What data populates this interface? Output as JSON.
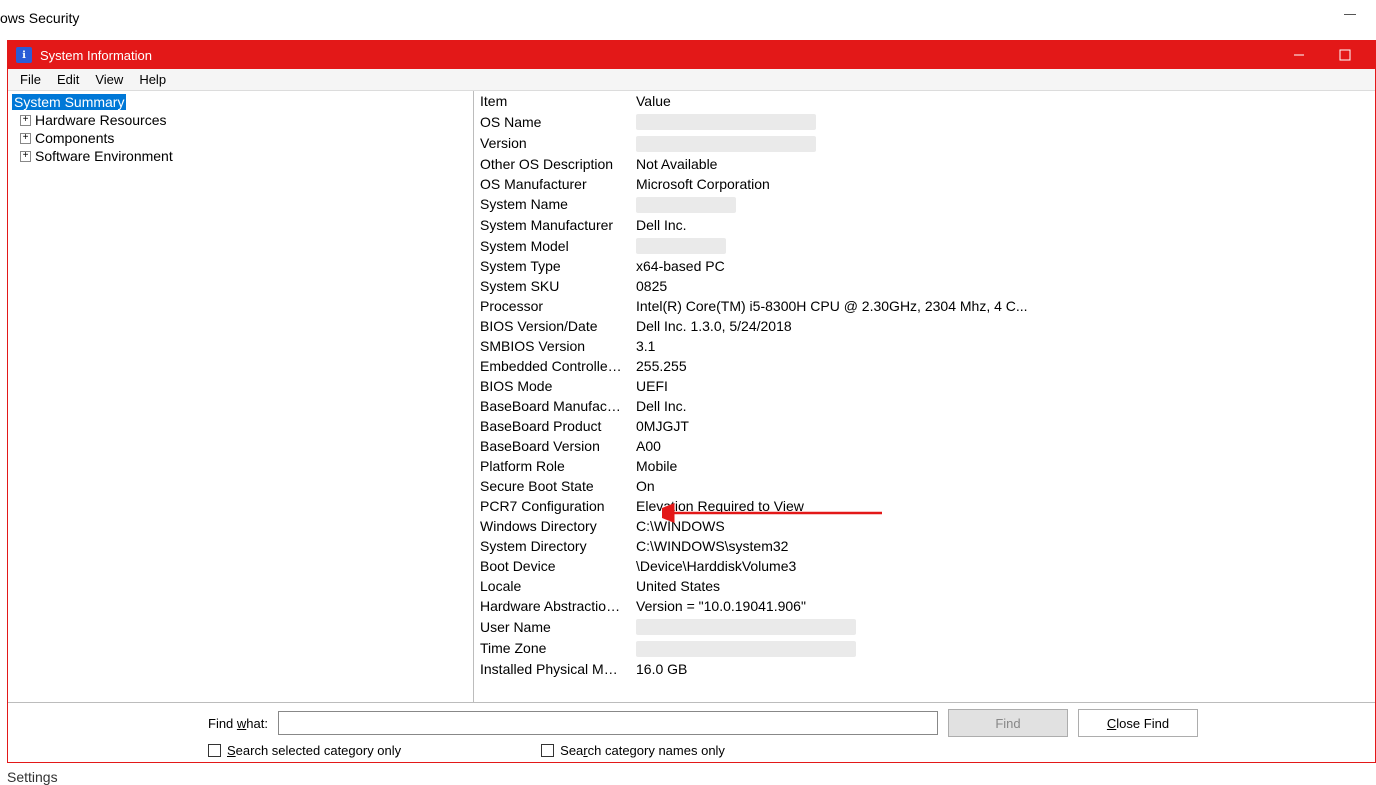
{
  "background": {
    "title_fragment": "ows Security",
    "settings_fragment": "Settings"
  },
  "msinfo": {
    "title": "System Information",
    "menu": {
      "file": "File",
      "edit": "Edit",
      "view": "View",
      "help": "Help"
    },
    "tree": {
      "root": "System Summary",
      "children": [
        "Hardware Resources",
        "Components",
        "Software Environment"
      ]
    },
    "headers": {
      "item": "Item",
      "value": "Value"
    },
    "rows": [
      {
        "item": "OS Name",
        "value": "",
        "redact_w": 180
      },
      {
        "item": "Version",
        "value": "",
        "redact_w": 180
      },
      {
        "item": "Other OS Description",
        "value": "Not Available"
      },
      {
        "item": "OS Manufacturer",
        "value": "Microsoft Corporation"
      },
      {
        "item": "System Name",
        "value": "",
        "redact_w": 100
      },
      {
        "item": "System Manufacturer",
        "value": "Dell Inc."
      },
      {
        "item": "System Model",
        "value": "",
        "redact_w": 90
      },
      {
        "item": "System Type",
        "value": "x64-based PC"
      },
      {
        "item": "System SKU",
        "value": "0825"
      },
      {
        "item": "Processor",
        "value": "Intel(R) Core(TM) i5-8300H CPU @ 2.30GHz, 2304 Mhz, 4 C..."
      },
      {
        "item": "BIOS Version/Date",
        "value": "Dell Inc. 1.3.0, 5/24/2018"
      },
      {
        "item": "SMBIOS Version",
        "value": "3.1"
      },
      {
        "item": "Embedded Controller V...",
        "value": "255.255"
      },
      {
        "item": "BIOS Mode",
        "value": "UEFI"
      },
      {
        "item": "BaseBoard Manufacturer",
        "value": "Dell Inc."
      },
      {
        "item": "BaseBoard Product",
        "value": "0MJGJT"
      },
      {
        "item": "BaseBoard Version",
        "value": "A00"
      },
      {
        "item": "Platform Role",
        "value": "Mobile"
      },
      {
        "item": "Secure Boot State",
        "value": "On"
      },
      {
        "item": "PCR7 Configuration",
        "value": "Elevation Required to View"
      },
      {
        "item": "Windows Directory",
        "value": "C:\\WINDOWS"
      },
      {
        "item": "System Directory",
        "value": "C:\\WINDOWS\\system32"
      },
      {
        "item": "Boot Device",
        "value": "\\Device\\HarddiskVolume3"
      },
      {
        "item": "Locale",
        "value": "United States"
      },
      {
        "item": "Hardware Abstraction L...",
        "value": "Version = \"10.0.19041.906\""
      },
      {
        "item": "User Name",
        "value": "",
        "redact_w": 220
      },
      {
        "item": "Time Zone",
        "value": "",
        "redact_w": 220
      },
      {
        "item": "Installed Physical Mem...",
        "value": "16.0 GB"
      }
    ],
    "find": {
      "label_pre": "Find ",
      "label_u": "w",
      "label_post": "hat:",
      "find_btn": "Find",
      "close_pre": "",
      "close_u": "C",
      "close_post": "lose Find",
      "chk1_pre": "",
      "chk1_u": "S",
      "chk1_post": "earch selected category only",
      "chk2_pre": "Sea",
      "chk2_u": "r",
      "chk2_post": "ch category names only"
    }
  }
}
